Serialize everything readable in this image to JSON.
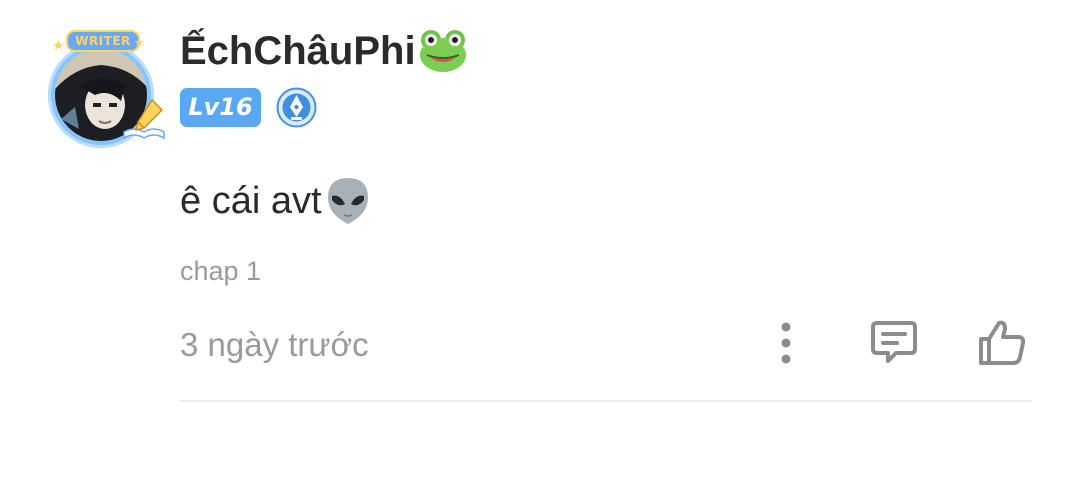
{
  "comment": {
    "author": {
      "name": "ẾchChâuPhi",
      "name_emoji_icon": "frog-face-emoji",
      "level": "Lv16",
      "avatar_frame_label": "WRITER",
      "role_icon": "fountain-pen-badge-icon"
    },
    "text": "ê cái avt",
    "text_emoji_icon": "alien-emoji",
    "chapter": "chap 1",
    "timestamp": "3 ngày trước",
    "actions": {
      "more_icon": "more-vertical-icon",
      "reply_icon": "comment-reply-icon",
      "like_icon": "thumbs-up-icon"
    }
  },
  "colors": {
    "level_badge": "#5aa8f3",
    "username": "#2b2b2b",
    "meta_text": "#9a9a9a",
    "icon_gray": "#8c8c8c",
    "divider": "#ececec"
  }
}
